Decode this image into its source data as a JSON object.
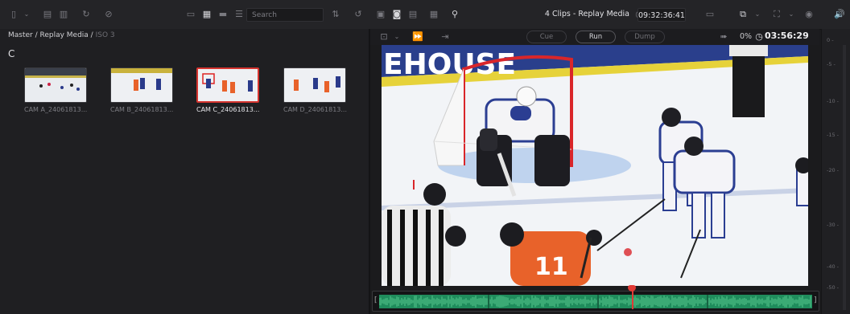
{
  "toolbar": {
    "search_placeholder": "Search",
    "clip_title": "4 Clips - Replay Media",
    "timecode": "09:32:36:41"
  },
  "bin": {
    "breadcrumb_path": "Master / Replay Media /",
    "breadcrumb_current": "ISO 3",
    "letter": "C",
    "clips": [
      {
        "name": "CAM A_24061813..."
      },
      {
        "name": "CAM B_24061813..."
      },
      {
        "name": "CAM C_24061813...",
        "selected": true
      },
      {
        "name": "CAM D_24061813..."
      }
    ]
  },
  "viewer": {
    "cue_label": "Cue",
    "run_label": "Run",
    "dump_label": "Dump",
    "zoom": "0%",
    "timecode": "03:56:29",
    "rink_text": "EHOUSE"
  },
  "meter": {
    "ticks": [
      "0 -",
      "-5 -",
      "-10 -",
      "-15 -",
      "-20 -",
      "-30 -",
      "-40 -",
      "-50 -"
    ]
  },
  "colors": {
    "selection": "#d6342f",
    "waveform": "#1f8c5c",
    "playhead": "#e23a35"
  }
}
